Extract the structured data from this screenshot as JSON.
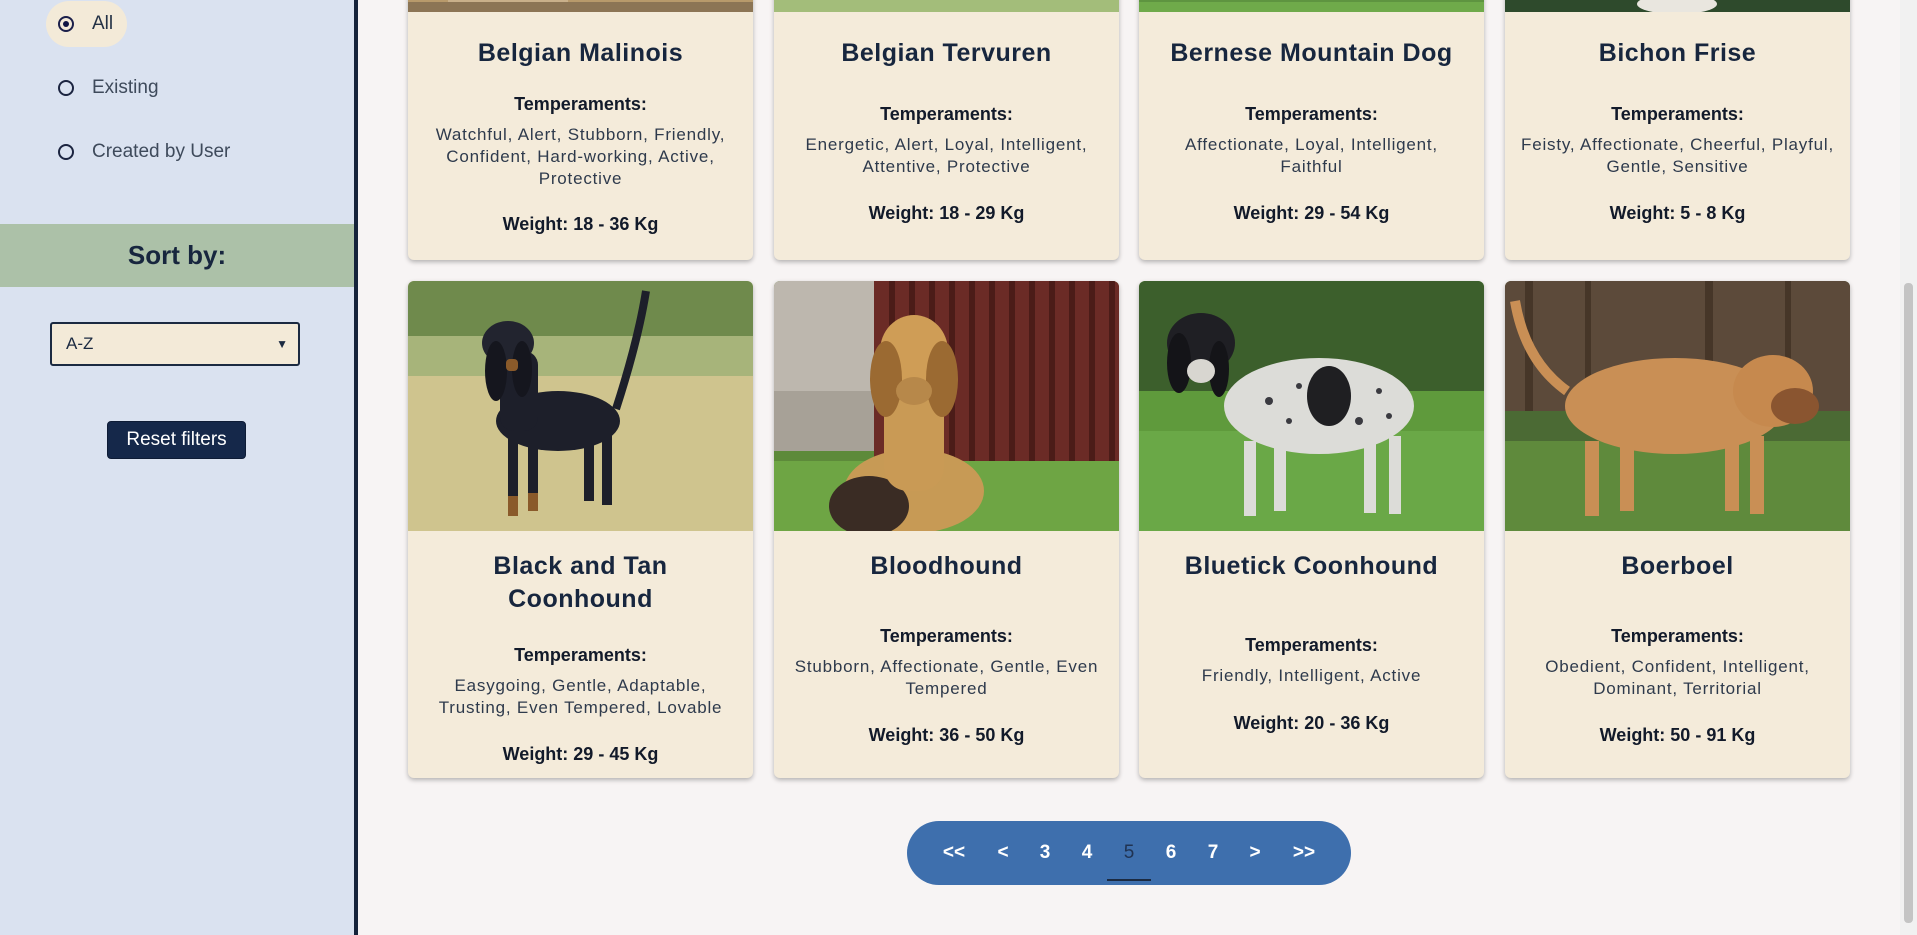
{
  "filters": {
    "options": [
      {
        "label": "All",
        "selected": true
      },
      {
        "label": "Existing",
        "selected": false
      },
      {
        "label": "Created by User",
        "selected": false
      }
    ]
  },
  "sort": {
    "title": "Sort by:",
    "selected": "A-Z"
  },
  "reset_label": "Reset filters",
  "temperaments_label": "Temperaments:",
  "cards": [
    {
      "name": "Belgian Malinois",
      "temperaments": "Watchful, Alert, Stubborn, Friendly, Confident, Hard-working, Active, Protective",
      "weight": "Weight: 18 - 36 Kg"
    },
    {
      "name": "Belgian Tervuren",
      "temperaments": "Energetic, Alert, Loyal, Intelligent, Attentive, Protective",
      "weight": "Weight: 18 - 29 Kg"
    },
    {
      "name": "Bernese Mountain Dog",
      "temperaments": "Affectionate, Loyal, Intelligent, Faithful",
      "weight": "Weight: 29 - 54 Kg"
    },
    {
      "name": "Bichon Frise",
      "temperaments": "Feisty, Affectionate, Cheerful, Playful, Gentle, Sensitive",
      "weight": "Weight: 5 - 8 Kg"
    },
    {
      "name": "Black and Tan Coonhound",
      "temperaments": "Easygoing, Gentle, Adaptable, Trusting, Even Tempered, Lovable",
      "weight": "Weight: 29 - 45 Kg"
    },
    {
      "name": "Bloodhound",
      "temperaments": "Stubborn, Affectionate, Gentle, Even Tempered",
      "weight": "Weight: 36 - 50 Kg"
    },
    {
      "name": "Bluetick Coonhound",
      "temperaments": "Friendly, Intelligent, Active",
      "weight": "Weight: 20 - 36 Kg"
    },
    {
      "name": "Boerboel",
      "temperaments": "Obedient, Confident, Intelligent, Dominant, Territorial",
      "weight": "Weight: 50 - 91 Kg"
    }
  ],
  "pagination": {
    "items": [
      "<<",
      "<",
      "3",
      "4",
      "5",
      "6",
      "7",
      ">",
      ">>"
    ],
    "current": "5"
  },
  "colors": {
    "sidebar_bg": "#dae2f0",
    "sort_header_bg": "#acc1a8",
    "card_bg": "#f4ebda",
    "pager_bg": "#3e6fad",
    "button_bg": "#15284a"
  }
}
